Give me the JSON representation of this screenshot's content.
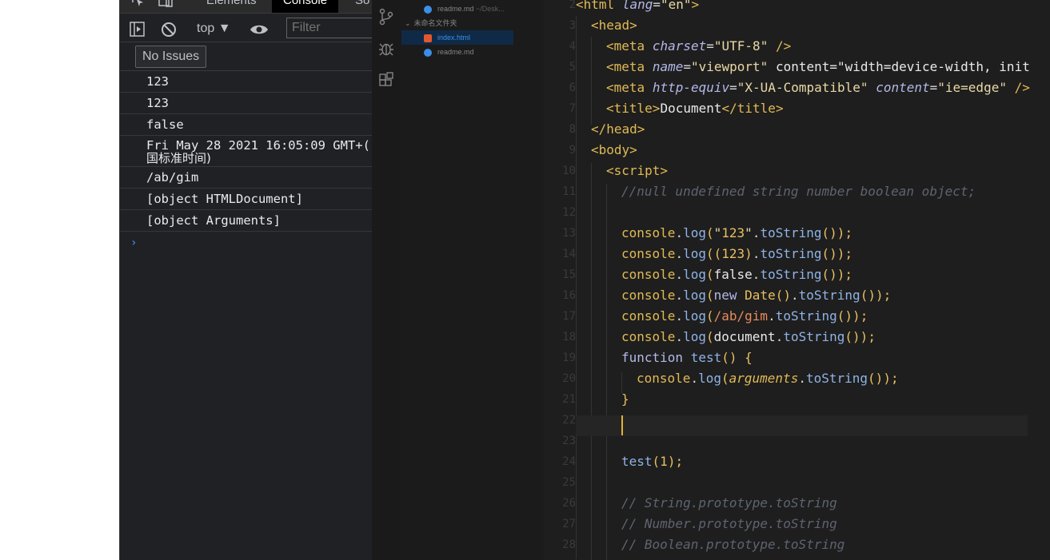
{
  "devtools": {
    "tabs": [
      {
        "label": "Elements",
        "active": false
      },
      {
        "label": "Console",
        "active": true
      },
      {
        "label": "So",
        "active": false
      }
    ],
    "toolbar": {
      "context": "top ▼",
      "filter_placeholder": "Filter"
    },
    "issues_label": "No Issues",
    "console_lines": [
      {
        "text": "123",
        "sub": ""
      },
      {
        "text": "123",
        "sub": ""
      },
      {
        "text": "false",
        "sub": ""
      },
      {
        "text": "Fri May 28 2021 16:05:09 GMT+(",
        "sub": "国标准时间)"
      },
      {
        "text": "/ab/gim",
        "sub": ""
      },
      {
        "text": "[object HTMLDocument]",
        "sub": ""
      },
      {
        "text": "[object Arguments]",
        "sub": ""
      }
    ],
    "prompt_symbol": "›"
  },
  "explorer": {
    "items": [
      {
        "label": "readme.md",
        "path": "~/Desk...",
        "kind": "md"
      },
      {
        "label": "未命名文件夹",
        "kind": "folder"
      },
      {
        "label": "index.html",
        "kind": "html",
        "selected": true
      },
      {
        "label": "readme.md",
        "kind": "md"
      }
    ]
  },
  "editor": {
    "line_numbers": [
      "2",
      "3",
      "4",
      "5",
      "6",
      "7",
      "8",
      "9",
      "10",
      "11",
      "12",
      "13",
      "14",
      "15",
      "16",
      "17",
      "18",
      "19",
      "20",
      "21",
      "22",
      "23",
      "24",
      "25",
      "26",
      "27",
      "28"
    ],
    "lines": [
      "<html lang=\"en\">",
      "<head>",
      "<meta charset=\"UTF-8\" />",
      "<meta name=\"viewport\" content=\"width=device-width, init",
      "<meta http-equiv=\"X-UA-Compatible\" content=\"ie=edge\" />",
      "<title>Document</title>",
      "</head>",
      "<body>",
      "<script>",
      "//null undefined string number boolean object;",
      "",
      "console.log(\"123\".toString());",
      "console.log((123).toString());",
      "console.log(false.toString());",
      "console.log(new Date().toString());",
      "console.log(/ab/gim.toString());",
      "console.log(document.toString());",
      "function test() {",
      "console.log(arguments.toString());",
      "}",
      "",
      "",
      "test(1);",
      "",
      "// String.prototype.toString",
      "// Number.prototype.toString",
      "// Boolean.prototype.toString"
    ]
  }
}
